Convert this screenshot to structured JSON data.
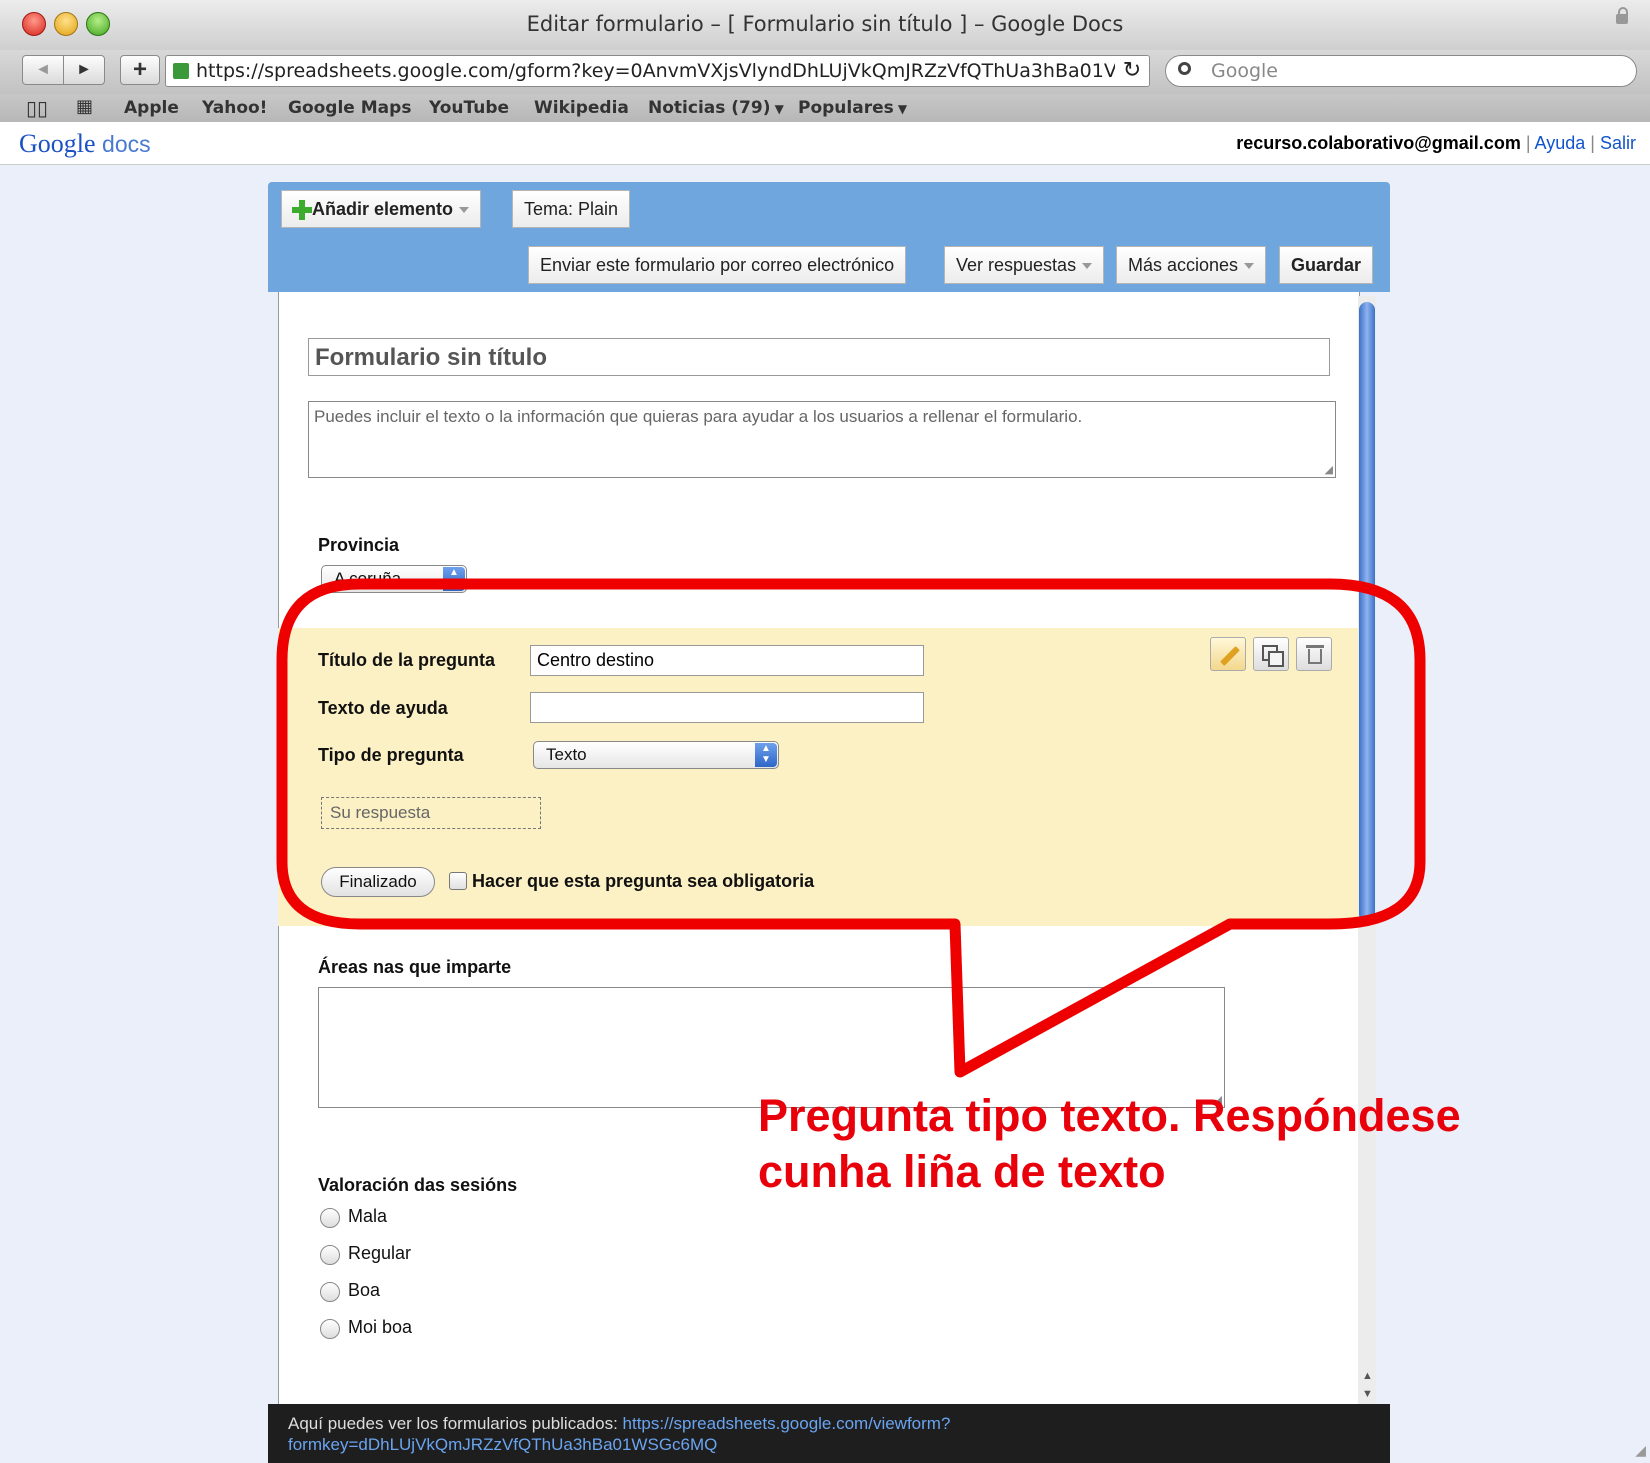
{
  "window": {
    "title": "Editar formulario – [ Formulario sin título ] – Google Docs"
  },
  "toolbar": {
    "back_icon": "◄",
    "forward_icon": "►",
    "add_icon": "+",
    "url": "https://spreadsheets.google.com/gform?key=0AnvmVXjsVlyndDhLUjVkQmJRZzVfQThUa3hBa01V",
    "reload_icon": "↻",
    "search_placeholder": "Google"
  },
  "bookmarks": {
    "items": [
      "Apple",
      "Yahoo!",
      "Google Maps",
      "YouTube",
      "Wikipedia",
      "Noticias (79)",
      "Populares"
    ]
  },
  "gdocs": {
    "logo_google": "Google",
    "logo_docs": "docs",
    "user_email": "recurso.colaborativo@gmail.com",
    "sep": "|",
    "help": "Ayuda",
    "signout": "Salir"
  },
  "form_toolbar": {
    "add_item": "Añadir elemento",
    "theme": "Tema:  Plain",
    "email_form": "Enviar este formulario por correo electrónico",
    "view_responses": "Ver respuestas",
    "more_actions": "Más acciones",
    "save": "Guardar"
  },
  "form": {
    "title_value": "Formulario sin título",
    "description_value": "Puedes incluir el texto o la información que quieras para ayudar a los usuarios a rellenar el formulario.",
    "q_province": {
      "label": "Provincia",
      "selected": "A coruña"
    },
    "edit_question": {
      "title_label": "Título de la pregunta",
      "title_value": "Centro destino",
      "help_label": "Texto de ayuda",
      "help_value": "",
      "type_label": "Tipo de pregunta",
      "type_selected": "Texto",
      "answer_placeholder": "Su respuesta",
      "done_button": "Finalizado",
      "required_label": "Hacer que esta pregunta sea obligatoria"
    },
    "q_areas": {
      "label": "Áreas nas que imparte"
    },
    "q_rating": {
      "label": "Valoración das sesións",
      "options": [
        "Mala",
        "Regular",
        "Boa",
        "Moi boa"
      ]
    }
  },
  "status_bar": {
    "text": "Aquí puedes ver los formularios publicados: ",
    "link_line1": "https://spreadsheets.google.com/viewform?",
    "link_line2": "formkey=dDhLUjVkQmJRZzVfQThUa3hBa01WSGc6MQ"
  },
  "annotation": {
    "line1": "Pregunta tipo texto. Respóndese",
    "line2": "cunha liña de texto",
    "color": "#e8000b"
  },
  "colors": {
    "toolbar_blue": "#6ea6dd",
    "edit_highlight": "#fcf0c5",
    "link_blue": "#1155cc"
  }
}
